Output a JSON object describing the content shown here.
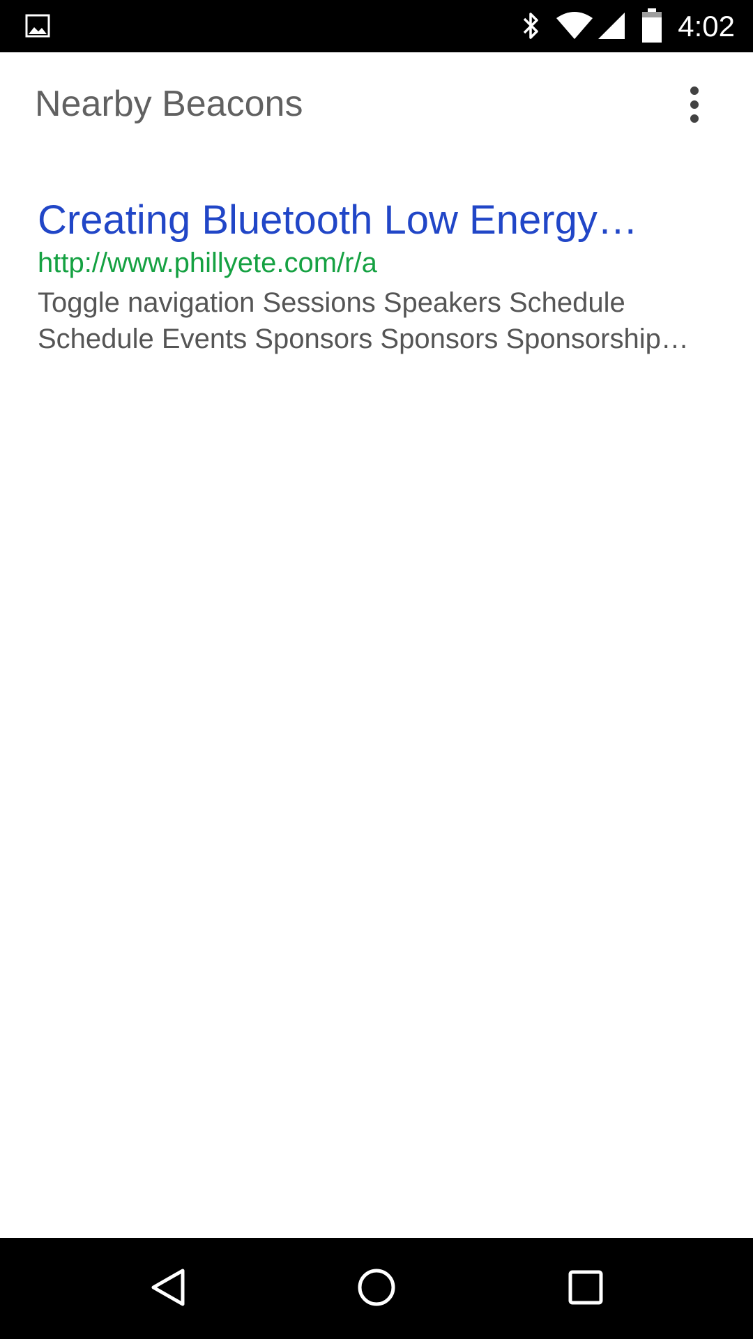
{
  "status_bar": {
    "time": "4:02",
    "icons": [
      "image-notification-icon",
      "bluetooth-icon",
      "wifi-icon",
      "cell-signal-icon",
      "battery-icon"
    ]
  },
  "app_bar": {
    "title": "Nearby Beacons",
    "overflow_icon": "more-vert-icon"
  },
  "beacons": [
    {
      "title": "Creating Bluetooth Low Energy…",
      "url": "http://www.phillyete.com/r/a",
      "description": "Toggle navigation Sessions Speakers Schedule Schedule Events Sponsors Sponsors Sponsorship…"
    }
  ],
  "nav_bar": {
    "buttons": [
      "back-icon",
      "home-icon",
      "recents-icon"
    ]
  },
  "colors": {
    "title_link": "#2146c7",
    "url": "#15a142",
    "description": "#555555",
    "app_title": "#616161",
    "system_bars": "#000000"
  }
}
